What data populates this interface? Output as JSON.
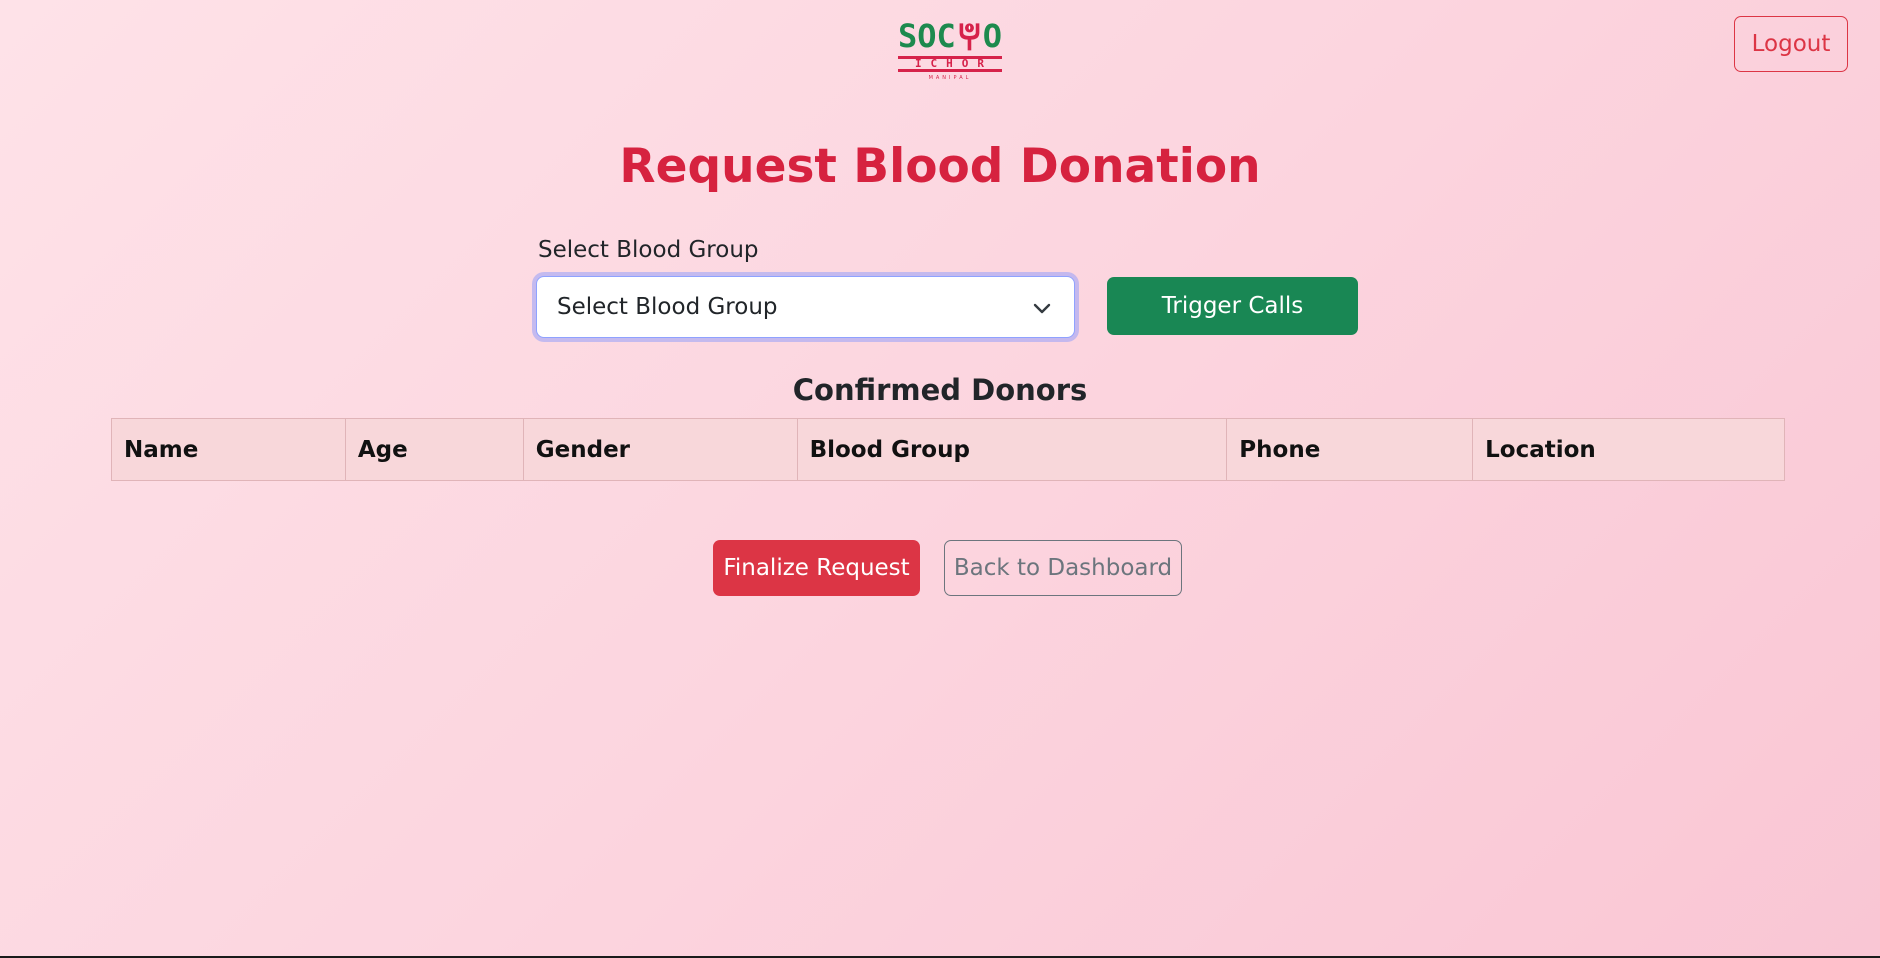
{
  "logo": {
    "line1_left": "SOC",
    "line1_right": "O",
    "line2": "ICHOR",
    "line3": "MANIPAL",
    "green": "#1d8a4e",
    "red": "#d6224a"
  },
  "header": {
    "logout_label": "Logout"
  },
  "page": {
    "title": "Request Blood Donation"
  },
  "form": {
    "blood_group_label": "Select Blood Group",
    "blood_group_selected": "Select Blood Group",
    "trigger_label": "Trigger Calls"
  },
  "donors": {
    "heading": "Confirmed Donors",
    "columns": [
      "Name",
      "Age",
      "Gender",
      "Blood Group",
      "Phone",
      "Location"
    ],
    "rows": []
  },
  "actions": {
    "finalize_label": "Finalize Request",
    "back_label": "Back to Dashboard"
  },
  "colors": {
    "title": "#d6223f",
    "success": "#198754",
    "danger": "#dc3545",
    "secondary": "#6c757d",
    "table_header_bg": "#f8d7da"
  }
}
